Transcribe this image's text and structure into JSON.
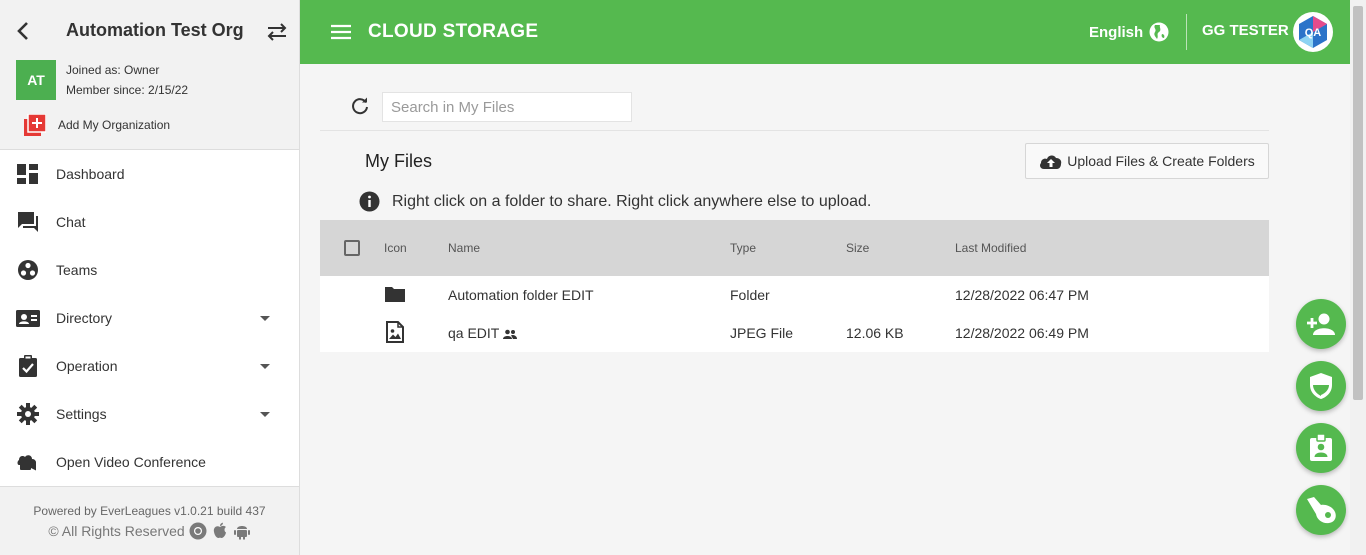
{
  "sidebar": {
    "org_name": "Automation Test Org",
    "avatar_initials": "AT",
    "joined_as": "Joined as: Owner",
    "member_since": "Member since: 2/15/22",
    "add_org_label": "Add My Organization",
    "items": [
      {
        "label": "Dashboard",
        "icon": "dashboard-icon"
      },
      {
        "label": "Chat",
        "icon": "chat-icon"
      },
      {
        "label": "Teams",
        "icon": "teams-icon"
      },
      {
        "label": "Directory",
        "icon": "directory-icon",
        "expandable": true
      },
      {
        "label": "Operation",
        "icon": "operation-icon",
        "expandable": true
      },
      {
        "label": "Settings",
        "icon": "gear-icon",
        "expandable": true
      },
      {
        "label": "Open Video Conference",
        "icon": "video-icon"
      }
    ],
    "footer": {
      "powered_by": "Powered by EverLeagues v1.0.21 build 437",
      "rights": "© All Rights Reserved"
    }
  },
  "header": {
    "title": "CLOUD STORAGE",
    "language": "English",
    "user_name": "GG TESTER",
    "user_avatar_text": "QA"
  },
  "main": {
    "search_placeholder": "Search in My Files",
    "title": "My Files",
    "upload_label": "Upload Files & Create Folders",
    "info_text": "Right click on a folder to share. Right click anywhere else to upload.",
    "columns": {
      "icon": "Icon",
      "name": "Name",
      "type": "Type",
      "size": "Size",
      "modified": "Last Modified"
    },
    "rows": [
      {
        "icon": "folder-icon",
        "name": "Automation folder EDIT",
        "type": "Folder",
        "size": "",
        "modified": "12/28/2022 06:47 PM",
        "shared": false
      },
      {
        "icon": "image-file-icon",
        "name": "qa EDIT",
        "type": "JPEG File",
        "size": "12.06 KB",
        "modified": "12/28/2022 06:49 PM",
        "shared": true
      }
    ]
  },
  "colors": {
    "brand": "#55b94f",
    "table_header": "#d6d6d6",
    "add_org": "#e53935"
  },
  "fabs": [
    "add-person-icon",
    "shield-icon",
    "badge-icon",
    "whistle-icon"
  ]
}
